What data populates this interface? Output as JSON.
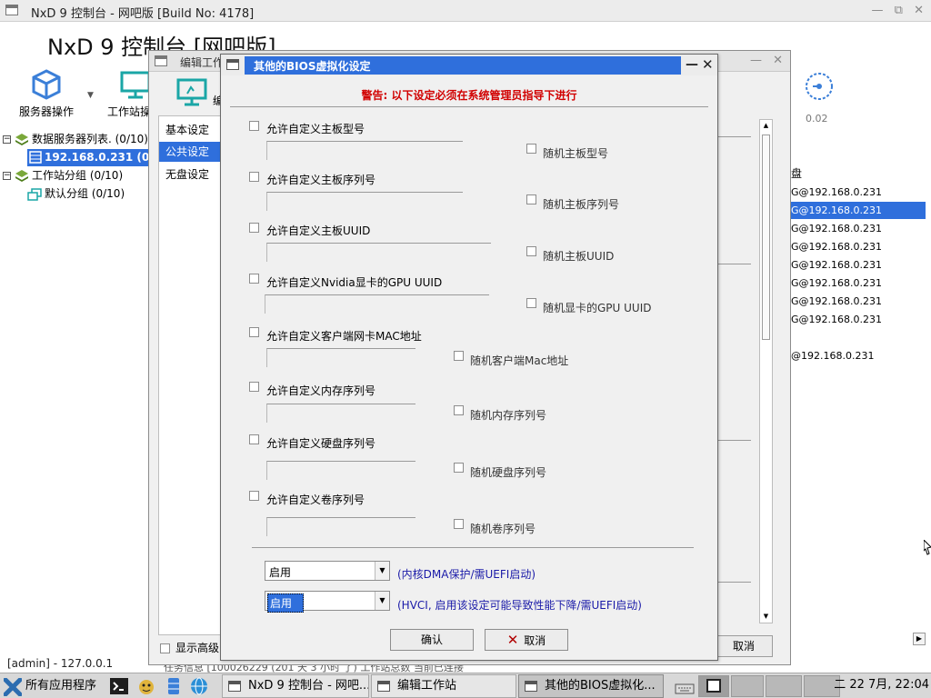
{
  "main_window": {
    "title": "NxD 9 控制台 - 网吧版 [Build No: 4178]",
    "heading": "NxD 9 控制台 [网吧版]",
    "toolbar": {
      "server_ops": "服务器操作",
      "workstation_ops": "工作站操",
      "gauge_value": "0.02"
    },
    "tree": {
      "root_servers": "数据服务器列表. (0/10)",
      "server_ip": "192.168.0.231 (0/",
      "root_groups": "工作站分组 (0/10)",
      "default_group": "默认分组 (0/10)"
    },
    "right_list": {
      "header": "盘",
      "items": [
        "G@192.168.0.231",
        "G@192.168.0.231",
        "G@192.168.0.231",
        "G@192.168.0.231",
        "G@192.168.0.231",
        "G@192.168.0.231",
        "G@192.168.0.231",
        "G@192.168.0.231",
        "@192.168.0.231"
      ],
      "selected_index": 1
    },
    "status_bar": "[admin] - 127.0.0.1",
    "background_strip": "任务信息 [100026229 (201 天 3 小时 了)          工作站总数     当前已连接"
  },
  "edit_dialog": {
    "title": "编辑工作",
    "tool_label": "编",
    "nav_items": [
      "基本设定",
      "公共设定",
      "无盘设定"
    ],
    "nav_selected": 1,
    "show_advanced": "显示高级",
    "cancel": "取消"
  },
  "bios_dialog": {
    "title": "其他的BIOS虚拟化设定",
    "warning": "警告: 以下设定必须在系统管理员指导下进行",
    "options": [
      {
        "label": "允许自定义主板型号",
        "random_label": "随机主板型号"
      },
      {
        "label": "允许自定义主板序列号",
        "random_label": "随机主板序列号"
      },
      {
        "label": "允许自定义主板UUID",
        "random_label": "随机主板UUID"
      },
      {
        "label": "允许自定义Nvidia显卡的GPU UUID",
        "random_label": "随机显卡的GPU UUID"
      },
      {
        "label": "允许自定义客户端网卡MAC地址",
        "random_label": "随机客户端Mac地址"
      },
      {
        "label": "允许自定义内存序列号",
        "random_label": "随机内存序列号"
      },
      {
        "label": "允许自定义硬盘序列号",
        "random_label": "随机硬盘序列号"
      },
      {
        "label": "允许自定义卷序列号",
        "random_label": "随机卷序列号"
      }
    ],
    "combo1": {
      "value": "启用",
      "note": "(内核DMA保护/需UEFI启动)"
    },
    "combo2": {
      "value": "启用",
      "note": "(HVCI, 启用该设定可能导致性能下降/需UEFI启动)"
    },
    "ok": "确认",
    "cancel": "取消"
  },
  "taskbar": {
    "start": "所有应用程序",
    "tasks": [
      {
        "title": "NxD 9 控制台 - 网吧..."
      },
      {
        "title": "编辑工作站"
      },
      {
        "title": "其他的BIOS虚拟化..."
      }
    ],
    "clock": "二 22 7月, 22:04"
  },
  "colors": {
    "selection": "#2f6fdc",
    "warning": "#d10000",
    "note": "#1a1aa8",
    "icon_teal": "#1aa6a6",
    "icon_blue": "#3b7fd8"
  }
}
